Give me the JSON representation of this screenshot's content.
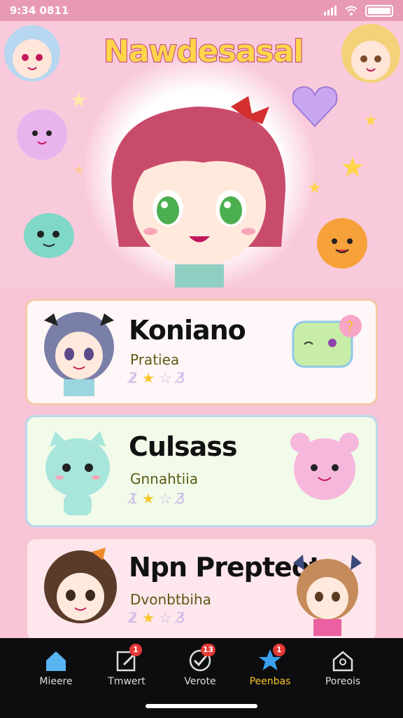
{
  "status": {
    "time": "9:34 0811"
  },
  "app": {
    "title": "Nawdesasal"
  },
  "cards": [
    {
      "name": "Koniano",
      "subtitle": "Pratiea",
      "rating": "2/3/3",
      "stars_pre": "2̸",
      "stars_post": "3̸"
    },
    {
      "name": "Culsass",
      "subtitle": "Gnnahtiia",
      "stars_pre": "1̸",
      "stars_post": "3̸"
    },
    {
      "name": "Npn Prepteot",
      "subtitle": "Dvonbtbiha",
      "stars_pre": "2̸",
      "stars_post": "3̸"
    }
  ],
  "nav": [
    {
      "label": "Mieere",
      "icon": "home-icon",
      "badge": ""
    },
    {
      "label": "Tmwert",
      "icon": "edit-icon",
      "badge": "1"
    },
    {
      "label": "Verote",
      "icon": "check-circle-icon",
      "badge": "13"
    },
    {
      "label": "Peenbas",
      "icon": "star-icon",
      "badge": "1"
    },
    {
      "label": "Poreois",
      "icon": "house-outline-icon",
      "badge": ""
    }
  ],
  "colors": {
    "accent": "#f7c52a",
    "pink": "#f7c4d8",
    "nav": "#0d0d10"
  }
}
